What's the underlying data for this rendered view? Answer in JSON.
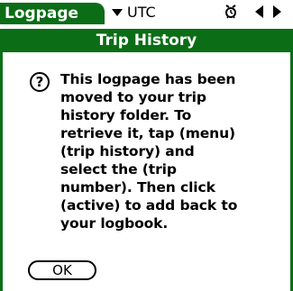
{
  "titlebar": {
    "app_name": "Logpage",
    "timezone": "UTC",
    "icons": [
      "alarm-icon",
      "arrow-left-icon",
      "arrow-right-icon"
    ]
  },
  "dialog": {
    "title": "Trip History",
    "icon": "question-icon",
    "icon_glyph": "?",
    "message": "This logpage has been\nmoved to your trip\nhistory folder. To\nretrieve it, tap (menu)\n(trip history) and\nselect the (trip\nnumber). Then click\n(active) to add back to\nyour logbook.",
    "ok_label": "OK"
  },
  "colors": {
    "accent": "#0b6d16",
    "background": "#ffffff",
    "text": "#000000"
  }
}
